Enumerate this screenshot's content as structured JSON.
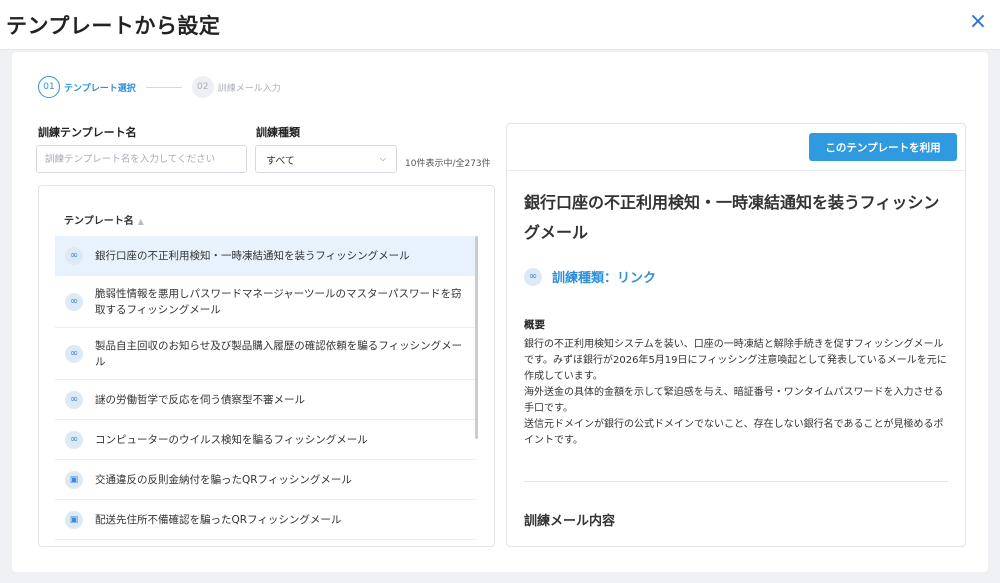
{
  "header": {
    "title": "テンプレートから設定",
    "close_icon": "×"
  },
  "stepper": [
    {
      "num": "01",
      "label": "テンプレート選択",
      "active": true
    },
    {
      "num": "02",
      "label": "訓練メール入力",
      "active": false
    }
  ],
  "filters": {
    "name_label": "訓練テンプレート名",
    "name_placeholder": "訓練テンプレート名を入力してください",
    "type_label": "訓練種類",
    "type_value": "すべて",
    "count": "10件表示中/全273件"
  },
  "list": {
    "column_header": "テンプレート名",
    "rows": [
      {
        "icon": "link-icon",
        "text": "銀行口座の不正利用検知・一時凍結通知を装うフィッシングメール",
        "selected": true
      },
      {
        "icon": "link-icon",
        "text": "脆弱性情報を悪用しパスワードマネージャーツールのマスターパスワードを窃取するフィッシングメール",
        "selected": false
      },
      {
        "icon": "link-icon",
        "text": "製品自主回収のお知らせ及び製品購入履歴の確認依頼を騙るフィッシングメール",
        "selected": false
      },
      {
        "icon": "link-icon",
        "text": "謎の労働哲学で反応を伺う債察型不審メール",
        "selected": false
      },
      {
        "icon": "link-icon",
        "text": "コンピューターのウイルス検知を騙るフィッシングメール",
        "selected": false
      },
      {
        "icon": "qr-icon",
        "text": "交通違反の反則金納付を騙ったQRフィッシングメール",
        "selected": false
      },
      {
        "icon": "qr-icon",
        "text": "配送先住所不備確認を騙ったQRフィッシングメール",
        "selected": false
      }
    ]
  },
  "detail": {
    "use_button": "このテンプレートを利用",
    "title": "銀行口座の不正利用検知・一時凍結通知を装うフィッシングメール",
    "type_label": "訓練種類：リンク",
    "summary_heading": "概要",
    "summary_lines": [
      "銀行の不正利用検知システムを装い、口座の一時凍結と解除手続きを促すフィッシングメールです。みずほ銀行が2026年5月19日にフィッシング注意喚起として発表しているメールを元に作成しています。",
      "海外送金の具体的金額を示して緊迫感を与え、暗証番号・ワンタイムパスワードを入力させる手口です。",
      "送信元ドメインが銀行の公式ドメインでないこと、存在しない銀行名であることが見極めるポイントです。"
    ],
    "mail_heading": "訓練メール内容"
  },
  "colors": {
    "accent": "#2f8fd8",
    "button": "#2f9ae0",
    "selected_row": "#e7f2fc"
  }
}
